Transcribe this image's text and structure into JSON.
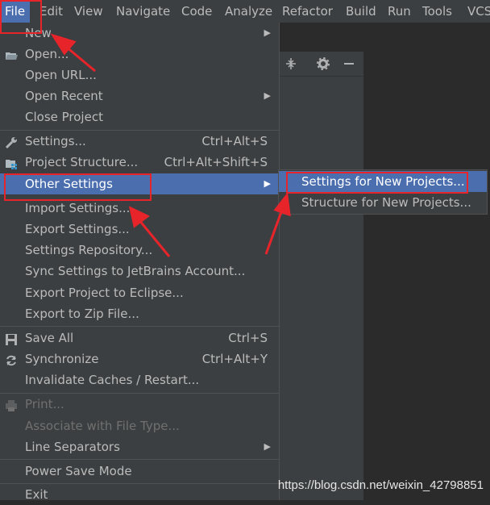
{
  "menubar": {
    "items": [
      "File",
      "Edit",
      "View",
      "Navigate",
      "Code",
      "Analyze",
      "Refactor",
      "Build",
      "Run",
      "Tools",
      "VCS"
    ]
  },
  "file_menu": {
    "new": "New",
    "open": "Open...",
    "open_url": "Open URL...",
    "open_recent": "Open Recent",
    "close_project": "Close Project",
    "settings": "Settings...",
    "settings_sc": "Ctrl+Alt+S",
    "project_structure": "Project Structure...",
    "project_structure_sc": "Ctrl+Alt+Shift+S",
    "other_settings": "Other Settings",
    "import_settings": "Import Settings...",
    "export_settings": "Export Settings...",
    "settings_repository": "Settings Repository...",
    "sync_settings": "Sync Settings to JetBrains Account...",
    "export_eclipse": "Export Project to Eclipse...",
    "export_zip": "Export to Zip File...",
    "save_all": "Save All",
    "save_all_sc": "Ctrl+S",
    "synchronize": "Synchronize",
    "synchronize_sc": "Ctrl+Alt+Y",
    "invalidate": "Invalidate Caches / Restart...",
    "print": "Print...",
    "associate": "Associate with File Type...",
    "line_separators": "Line Separators",
    "power_save": "Power Save Mode",
    "exit": "Exit"
  },
  "submenu": {
    "settings_new": "Settings for New Projects...",
    "structure_new": "Structure for New Projects..."
  },
  "watermark": "https://blog.csdn.net/weixin_42798851",
  "colors": {
    "selection": "#4b6eaf",
    "annotation": "#e8242b",
    "menu_bg": "#3c3f41"
  }
}
